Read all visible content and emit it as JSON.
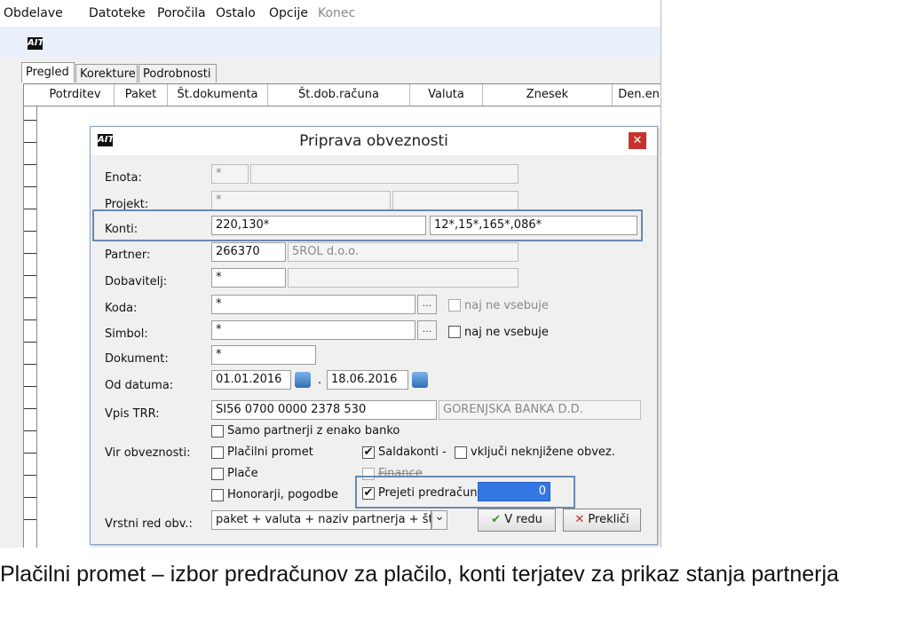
{
  "menu": [
    "Obdelave",
    "Datoteke",
    "Poročila",
    "Ostalo",
    "Opcije",
    "Konec"
  ],
  "logo_text": "AIT",
  "tabs": [
    "Pregled",
    "Korekture",
    "Podrobnosti"
  ],
  "grid_columns": [
    "Potrditev",
    "Paket",
    "Št.dokumenta",
    "Št.dob.računa",
    "Valuta",
    "Znesek",
    "Den.en"
  ],
  "dialog": {
    "title": "Priprava obveznosti",
    "close_glyph": "✕",
    "labels": {
      "enota": "Enota:",
      "projekt": "Projekt:",
      "konti": "Konti:",
      "partner": "Partner:",
      "dobavitelj": "Dobavitelj:",
      "koda": "Koda:",
      "simbol": "Simbol:",
      "dokument": "Dokument:",
      "od_datuma": "Od datuma:",
      "vpis_trr": "Vpis TRR:",
      "vir": "Vir obveznosti:",
      "vrstni_red": "Vrstni red obv.:"
    },
    "enota_value": "*",
    "projekt_value": "*",
    "konti_value1": "220,130*",
    "konti_value2": "12*,15*,165*,086*",
    "partner_code": "266370",
    "partner_name": "5ROL d.o.o.",
    "dobavitelj_value": "*",
    "koda_value": "*",
    "simbol_value": "*",
    "dokument_value": "*",
    "date_from": "01.01.2016",
    "date_sep": ".",
    "date_to": "18.06.2016",
    "trr_value": "SI56 0700 0000 2378 530",
    "trr_bank": "GORENJSKA BANKA D.D.",
    "browse_label": "...",
    "naj_ne_vsebuje": "naj ne vsebuje",
    "samo_partnerji": "Samo partnerji z enako banko",
    "placilni_promet": "Plačilni promet",
    "place": "Plače",
    "honorarji": "Honorarji, pogodbe",
    "saldakonti": "Saldakonti -",
    "vkljuci": "vključi neknjižene obvez.",
    "finance": "Finance",
    "prejeti": "Prejeti predračuni",
    "prejeti_count": "0",
    "vrstni_red_value": "paket + valuta + naziv partnerja + št.doku",
    "ok_button": "V redu",
    "cancel_button": "Prekliči",
    "check_glyph": "✔",
    "ok_icon_glyph": "✔",
    "cancel_icon_glyph": "✕",
    "dropdown_glyph": "⌄"
  },
  "caption": "Plačilni promet – izbor predračunov za plačilo, konti terjatev za prikaz stanja partnerja",
  "colors": {
    "highlight_border": "#6a88b0",
    "selected_field": "#3477e3",
    "close_button": "#c8322e"
  }
}
